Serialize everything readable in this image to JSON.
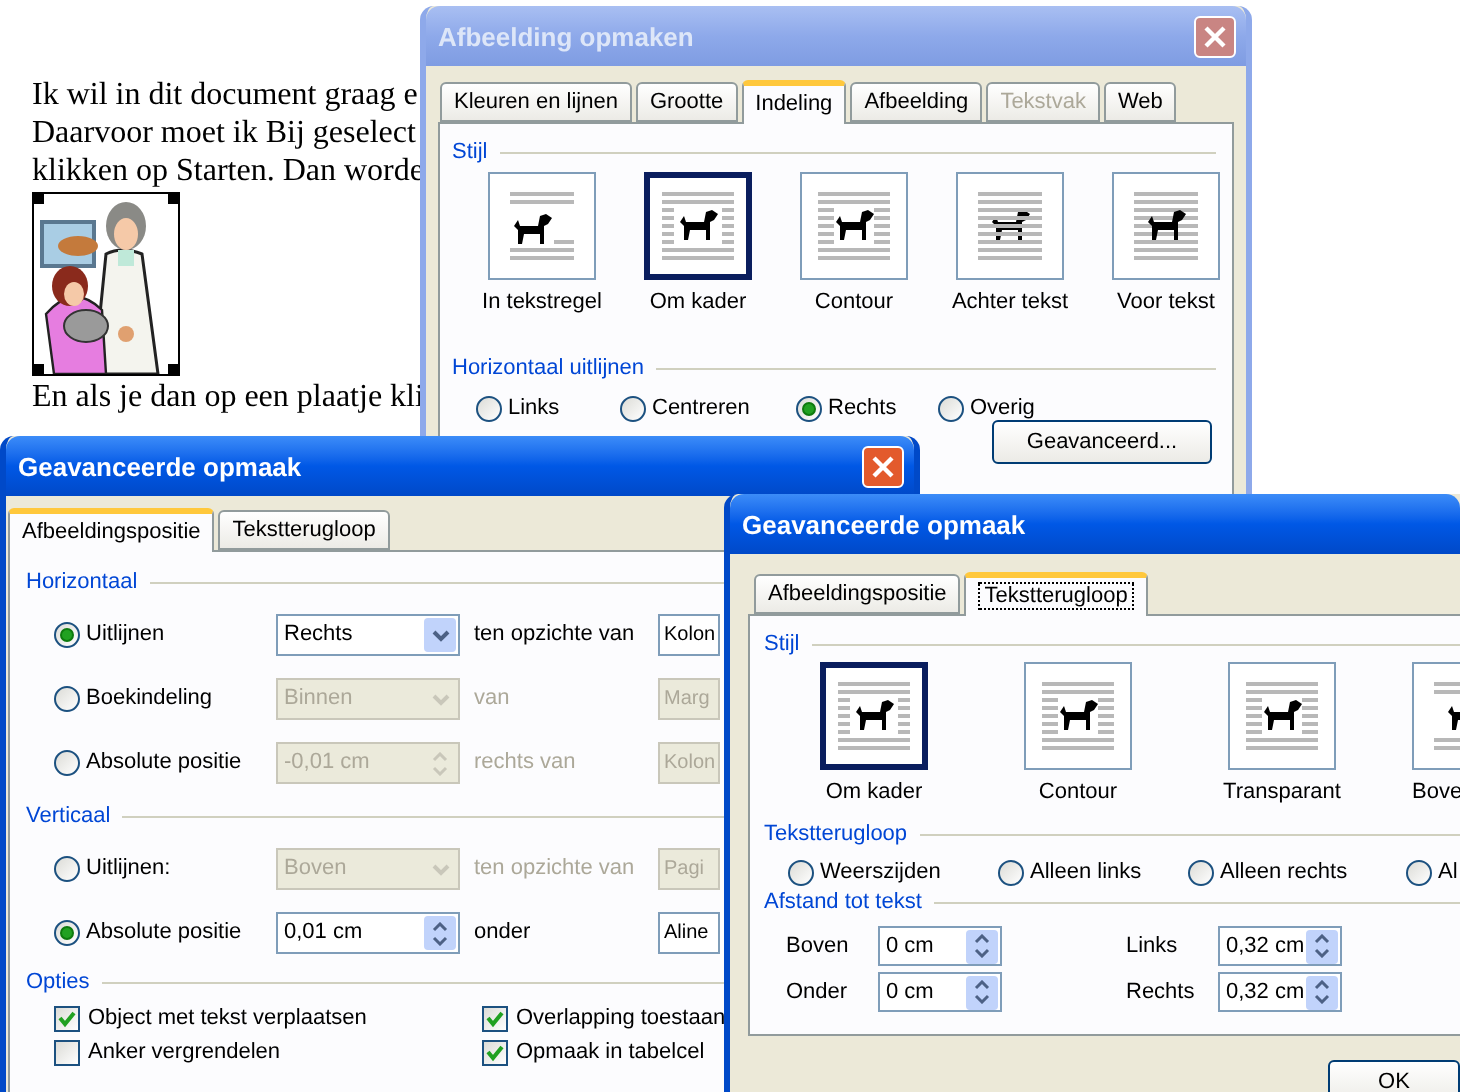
{
  "document": {
    "lines": [
      "Ik wil in dit document graag e",
      "Daarvoor moet ik Bij geselect",
      "klikken op Starten. Dan worde"
    ],
    "picture": {
      "kind": "picture"
    },
    "after_picture": "En als je dan op een plaatje kli"
  },
  "format_dialog": {
    "title": "Afbeelding opmaken",
    "tabs": [
      {
        "label": "Kleuren en lijnen",
        "selected": false,
        "disabled": false
      },
      {
        "label": "Grootte",
        "selected": false,
        "disabled": false
      },
      {
        "label": "Indeling",
        "selected": true,
        "disabled": false
      },
      {
        "label": "Afbeelding",
        "selected": false,
        "disabled": false
      },
      {
        "label": "Tekstvak",
        "selected": false,
        "disabled": true
      },
      {
        "label": "Web",
        "selected": false,
        "disabled": false
      }
    ],
    "style": {
      "label": "Stijl",
      "options": [
        {
          "label": "In tekstregel",
          "kind": "inline",
          "selected": false
        },
        {
          "label": "Om kader",
          "kind": "square",
          "selected": true
        },
        {
          "label": "Contour",
          "kind": "tight",
          "selected": false
        },
        {
          "label": "Achter tekst",
          "kind": "behind",
          "selected": false
        },
        {
          "label": "Voor tekst",
          "kind": "front",
          "selected": false
        }
      ]
    },
    "align": {
      "label": "Horizontaal uitlijnen",
      "options": [
        {
          "label": "Links",
          "selected": false
        },
        {
          "label": "Centreren",
          "selected": false
        },
        {
          "label": "Rechts",
          "selected": true
        },
        {
          "label": "Overig",
          "selected": false
        }
      ]
    },
    "advanced_button": "Geavanceerd..."
  },
  "position_dialog": {
    "title": "Geavanceerde opmaak",
    "tabs": [
      {
        "label": "Afbeeldingspositie",
        "selected": true
      },
      {
        "label": "Tekstterugloop",
        "selected": false
      }
    ],
    "sections": [
      {
        "label": "Horizontaal",
        "rows": [
          {
            "label": "Uitlijnen",
            "selected": true,
            "field": {
              "value": "Rechts",
              "kind": "select",
              "disabled": false
            },
            "relation": {
              "text": "ten opzichte van",
              "disabled": false
            },
            "target": {
              "value": "Kolon",
              "disabled": false
            }
          },
          {
            "label": "Boekindeling",
            "selected": false,
            "field": {
              "value": "Binnen",
              "kind": "select",
              "disabled": true
            },
            "relation": {
              "text": "van",
              "disabled": true
            },
            "target": {
              "value": "Marg",
              "disabled": true
            }
          },
          {
            "label": "Absolute positie",
            "selected": false,
            "field": {
              "value": "-0,01 cm",
              "kind": "spin",
              "disabled": true
            },
            "relation": {
              "text": "rechts van",
              "disabled": true
            },
            "target": {
              "value": "Kolon",
              "disabled": true
            }
          }
        ]
      },
      {
        "label": "Verticaal",
        "rows": [
          {
            "label": "Uitlijnen:",
            "selected": false,
            "field": {
              "value": "Boven",
              "kind": "select",
              "disabled": true
            },
            "relation": {
              "text": "ten opzichte van",
              "disabled": true
            },
            "target": {
              "value": "Pagi",
              "disabled": true
            }
          },
          {
            "label": "Absolute positie",
            "selected": true,
            "field": {
              "value": "0,01 cm",
              "kind": "spin",
              "disabled": false
            },
            "relation": {
              "text": "onder",
              "disabled": false
            },
            "target": {
              "value": "Aline",
              "disabled": false
            }
          }
        ]
      }
    ],
    "options": {
      "label": "Opties",
      "checkboxes": [
        {
          "label": "Object met tekst verplaatsen",
          "checked": true
        },
        {
          "label": "Overlapping toestaan",
          "checked": true
        },
        {
          "label": "Anker vergrendelen",
          "checked": false
        },
        {
          "label": "Opmaak in tabelcel",
          "checked": true
        }
      ]
    }
  },
  "wrap_dialog": {
    "title": "Geavanceerde opmaak",
    "tabs": [
      {
        "label": "Afbeeldingspositie",
        "selected": false
      },
      {
        "label": "Tekstterugloop",
        "selected": true
      }
    ],
    "style": {
      "label": "Stijl",
      "options": [
        {
          "label": "Om kader",
          "kind": "square",
          "selected": true
        },
        {
          "label": "Contour",
          "kind": "tight",
          "selected": false
        },
        {
          "label": "Transparant",
          "kind": "through",
          "selected": false
        },
        {
          "label": "Bove",
          "kind": "top_bottom",
          "selected": false
        }
      ]
    },
    "wrap": {
      "label": "Tekstterugloop",
      "options": [
        {
          "label": "Weerszijden",
          "selected": false
        },
        {
          "label": "Alleen links",
          "selected": false
        },
        {
          "label": "Alleen rechts",
          "selected": false
        },
        {
          "label": "Al",
          "selected": false
        }
      ]
    },
    "distance": {
      "label": "Afstand tot tekst",
      "fields": [
        {
          "label": "Boven",
          "value": "0 cm"
        },
        {
          "label": "Links",
          "value": "0,32 cm"
        },
        {
          "label": "Onder",
          "value": "0 cm"
        },
        {
          "label": "Rechts",
          "value": "0,32 cm"
        }
      ]
    },
    "buttons": [
      "OK"
    ]
  }
}
